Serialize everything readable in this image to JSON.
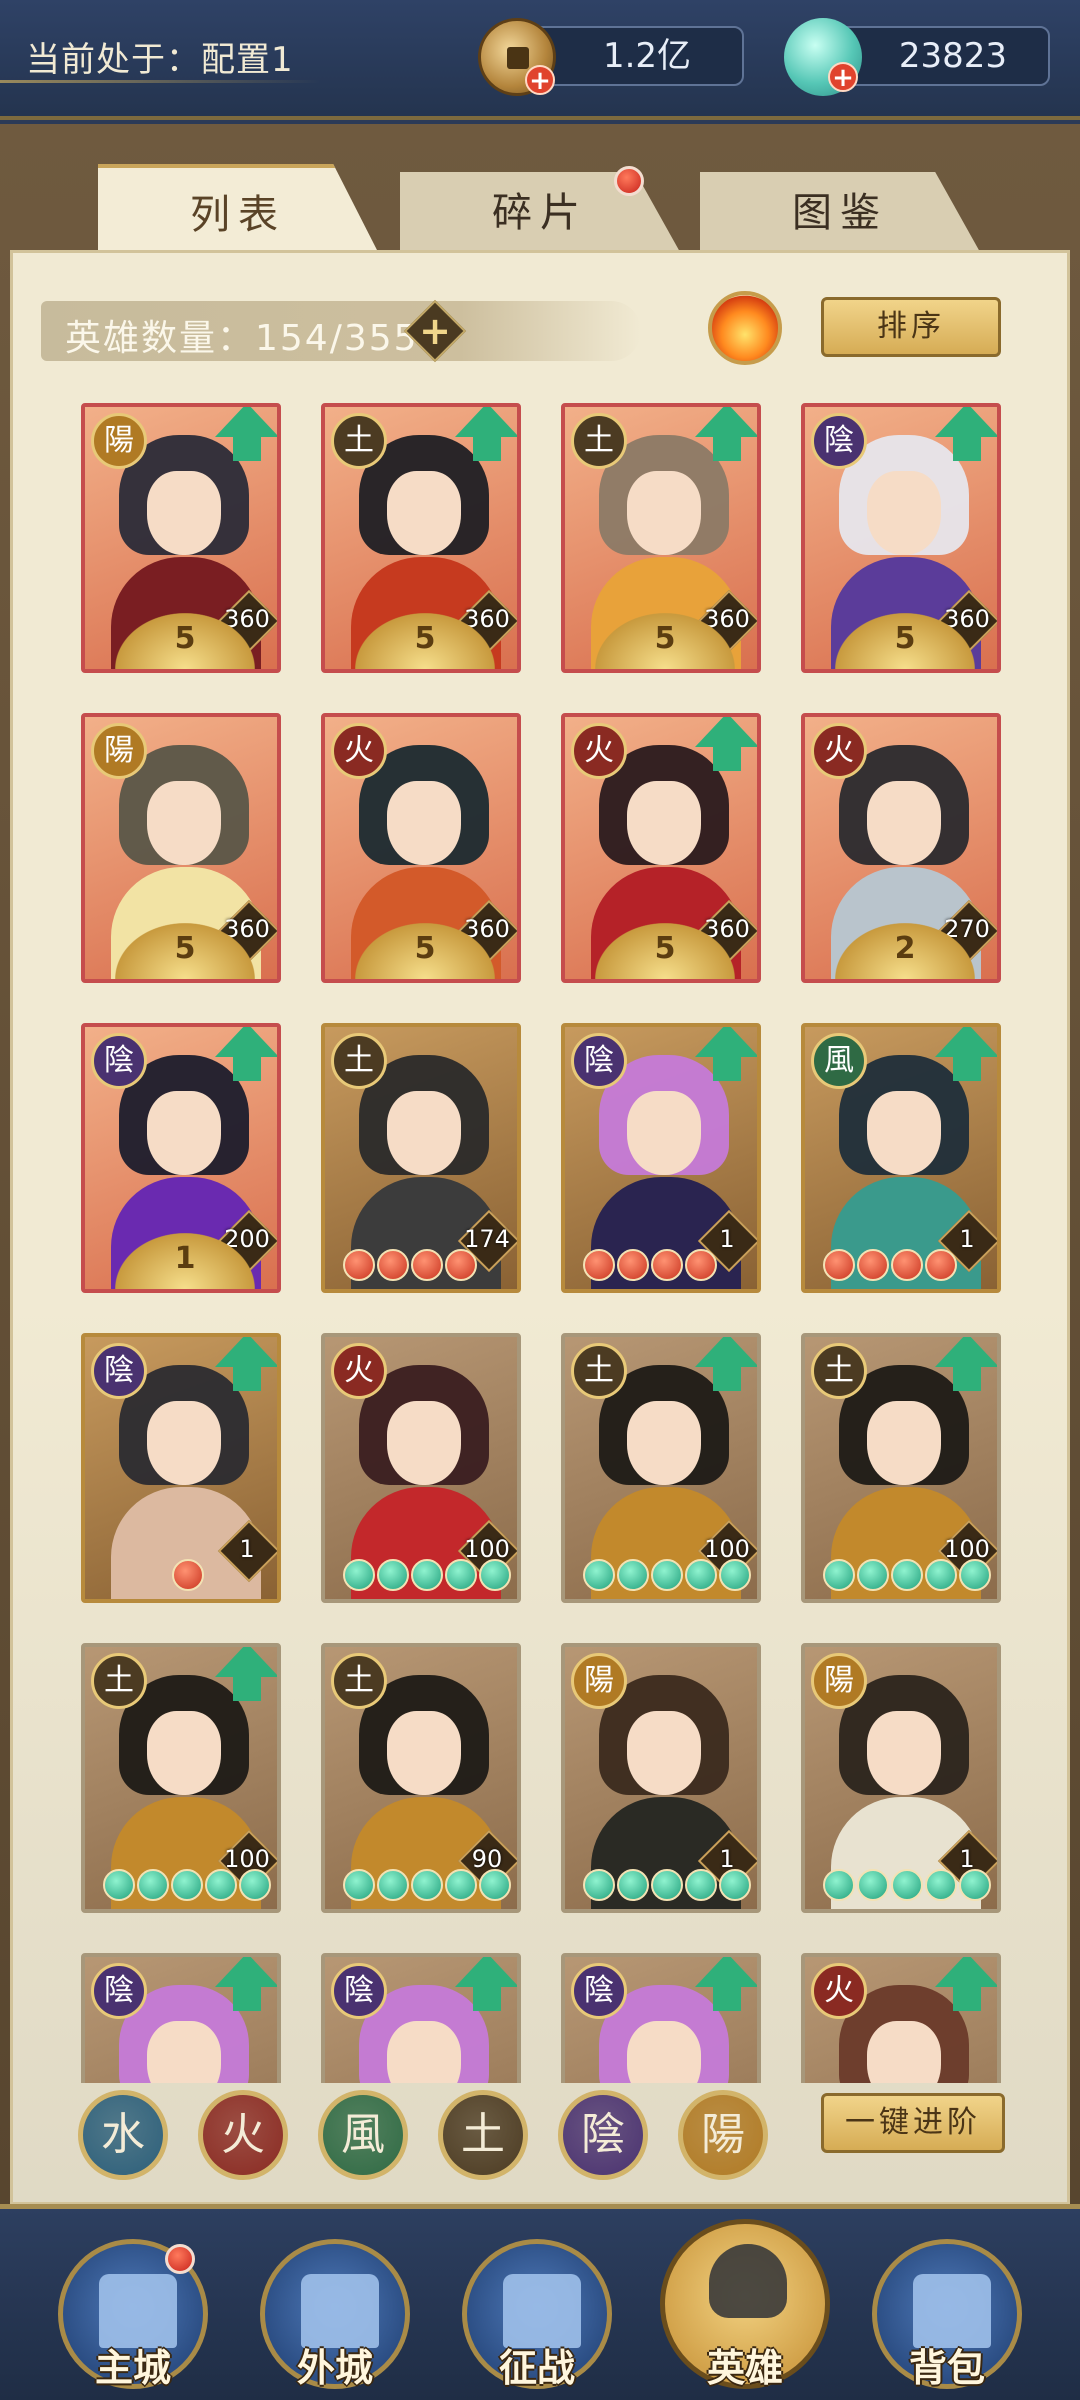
{
  "header": {
    "config_text": "当前处于：配置1",
    "coins": "1.2亿",
    "gems": "23823",
    "coin_icon": "coin-icon",
    "gem_icon": "gem-shell-icon"
  },
  "tabs": [
    {
      "label": "列表",
      "active": true
    },
    {
      "label": "碎片",
      "active": false,
      "badge": true
    },
    {
      "label": "图鉴",
      "active": false
    }
  ],
  "hero_count": {
    "label": "英雄数量：154/355",
    "plus": "+"
  },
  "sort_button": "排序",
  "advance_button": "一键进阶",
  "colors": {
    "upgrade_arrow": "#2fb07a",
    "card_border_red": "#c54d4d",
    "card_border_gold": "#b78a3c",
    "panel_bg": "#f1ead3"
  },
  "heroes": [
    {
      "element": "陽",
      "level": "360",
      "stars": "5",
      "upgrade": true,
      "frame": "red",
      "tone": "#2b2b38",
      "outfit": "#7a1e22"
    },
    {
      "element": "土",
      "level": "360",
      "stars": "5",
      "upgrade": true,
      "frame": "red",
      "tone": "#1f1f24",
      "outfit": "#c63a1f"
    },
    {
      "element": "土",
      "level": "360",
      "stars": "5",
      "upgrade": true,
      "frame": "red",
      "tone": "#8c7a66",
      "outfit": "#e8a23a"
    },
    {
      "element": "陰",
      "level": "360",
      "stars": "5",
      "upgrade": true,
      "frame": "red",
      "tone": "#e7e6ec",
      "outfit": "#5b3c9a"
    },
    {
      "element": "陽",
      "level": "360",
      "stars": "5",
      "upgrade": false,
      "frame": "red",
      "tone": "#5a5648",
      "outfit": "#f2e3a4"
    },
    {
      "element": "火",
      "level": "360",
      "stars": "5",
      "upgrade": false,
      "frame": "red",
      "tone": "#1b2a30",
      "outfit": "#d35a2a"
    },
    {
      "element": "火",
      "level": "360",
      "stars": "5",
      "upgrade": true,
      "frame": "red",
      "tone": "#2a1a1e",
      "outfit": "#b52228"
    },
    {
      "element": "火",
      "level": "270",
      "stars": "2",
      "upgrade": false,
      "frame": "red",
      "tone": "#2a2a2e",
      "outfit": "#b9c4cc"
    },
    {
      "element": "陰",
      "level": "200",
      "stars": "1",
      "upgrade": true,
      "frame": "red",
      "tone": "#1c1c2c",
      "outfit": "#6a2ab0"
    },
    {
      "element": "土",
      "level": "174",
      "beads": [
        "red",
        "red",
        "red",
        "red"
      ],
      "upgrade": false,
      "frame": "gold",
      "tone": "#2a2a2a",
      "outfit": "#3c3c3c"
    },
    {
      "element": "陰",
      "level": "1",
      "beads": [
        "red",
        "red",
        "red",
        "red"
      ],
      "upgrade": true,
      "frame": "gold",
      "tone": "#c57ad8",
      "outfit": "#2a2450"
    },
    {
      "element": "風",
      "level": "1",
      "beads": [
        "red",
        "red",
        "red",
        "red"
      ],
      "upgrade": true,
      "frame": "gold",
      "tone": "#1f2e3a",
      "outfit": "#3a9a8c"
    },
    {
      "element": "陰",
      "level": "1",
      "beads": [
        "red"
      ],
      "upgrade": true,
      "frame": "gold",
      "tone": "#2b2b30",
      "outfit": "#dcb9a0"
    },
    {
      "element": "火",
      "level": "100",
      "beads": [
        "green",
        "green",
        "green",
        "green",
        "green"
      ],
      "upgrade": false,
      "frame": "plain",
      "tone": "#3a1e20",
      "outfit": "#c3282b"
    },
    {
      "element": "土",
      "level": "100",
      "beads": [
        "green",
        "green",
        "green",
        "green",
        "green"
      ],
      "upgrade": true,
      "frame": "plain",
      "tone": "#1e1a16",
      "outfit": "#c2892c"
    },
    {
      "element": "土",
      "level": "100",
      "beads": [
        "green",
        "green",
        "green",
        "green",
        "green"
      ],
      "upgrade": true,
      "frame": "plain",
      "tone": "#1e1a16",
      "outfit": "#c2892c"
    },
    {
      "element": "土",
      "level": "100",
      "beads": [
        "green",
        "green",
        "green",
        "green",
        "green"
      ],
      "upgrade": true,
      "frame": "plain",
      "tone": "#1e1a16",
      "outfit": "#c2892c"
    },
    {
      "element": "土",
      "level": "90",
      "beads": [
        "green",
        "green",
        "green",
        "green",
        "green"
      ],
      "upgrade": false,
      "frame": "plain",
      "tone": "#1e1a16",
      "outfit": "#c2892c"
    },
    {
      "element": "陽",
      "level": "1",
      "beads": [
        "green",
        "green",
        "green",
        "green",
        "green"
      ],
      "upgrade": false,
      "frame": "plain",
      "tone": "#3b2a1e",
      "outfit": "#2a2a24"
    },
    {
      "element": "陽",
      "level": "1",
      "beads": [
        "green",
        "green",
        "green",
        "green",
        "green"
      ],
      "upgrade": false,
      "frame": "plain",
      "tone": "#2b241c",
      "outfit": "#e8e2d0"
    },
    {
      "element": "陰",
      "level": "",
      "upgrade": true,
      "frame": "plain",
      "tone": "#c57ad8",
      "outfit": "#c57ad8"
    },
    {
      "element": "陰",
      "level": "",
      "upgrade": true,
      "frame": "plain",
      "tone": "#c57ad8",
      "outfit": "#c57ad8"
    },
    {
      "element": "陰",
      "level": "",
      "upgrade": true,
      "frame": "plain",
      "tone": "#c57ad8",
      "outfit": "#c57ad8"
    },
    {
      "element": "火",
      "level": "",
      "upgrade": true,
      "frame": "plain",
      "tone": "#6a3a2a",
      "outfit": "#6a3a2a"
    }
  ],
  "filters": [
    {
      "label": "水",
      "color": "#2c5f7a"
    },
    {
      "label": "火",
      "color": "#8a2a22"
    },
    {
      "label": "風",
      "color": "#2f6a44"
    },
    {
      "label": "土",
      "color": "#4c3b22"
    },
    {
      "label": "陰",
      "color": "#4a3270"
    },
    {
      "label": "陽",
      "color": "#b07a24"
    }
  ],
  "nav": [
    {
      "label": "主城",
      "badge": true,
      "active": false
    },
    {
      "label": "外城",
      "badge": false,
      "active": false
    },
    {
      "label": "征战",
      "badge": false,
      "active": false
    },
    {
      "label": "英雄",
      "badge": false,
      "active": true
    },
    {
      "label": "背包",
      "badge": false,
      "active": false
    }
  ]
}
